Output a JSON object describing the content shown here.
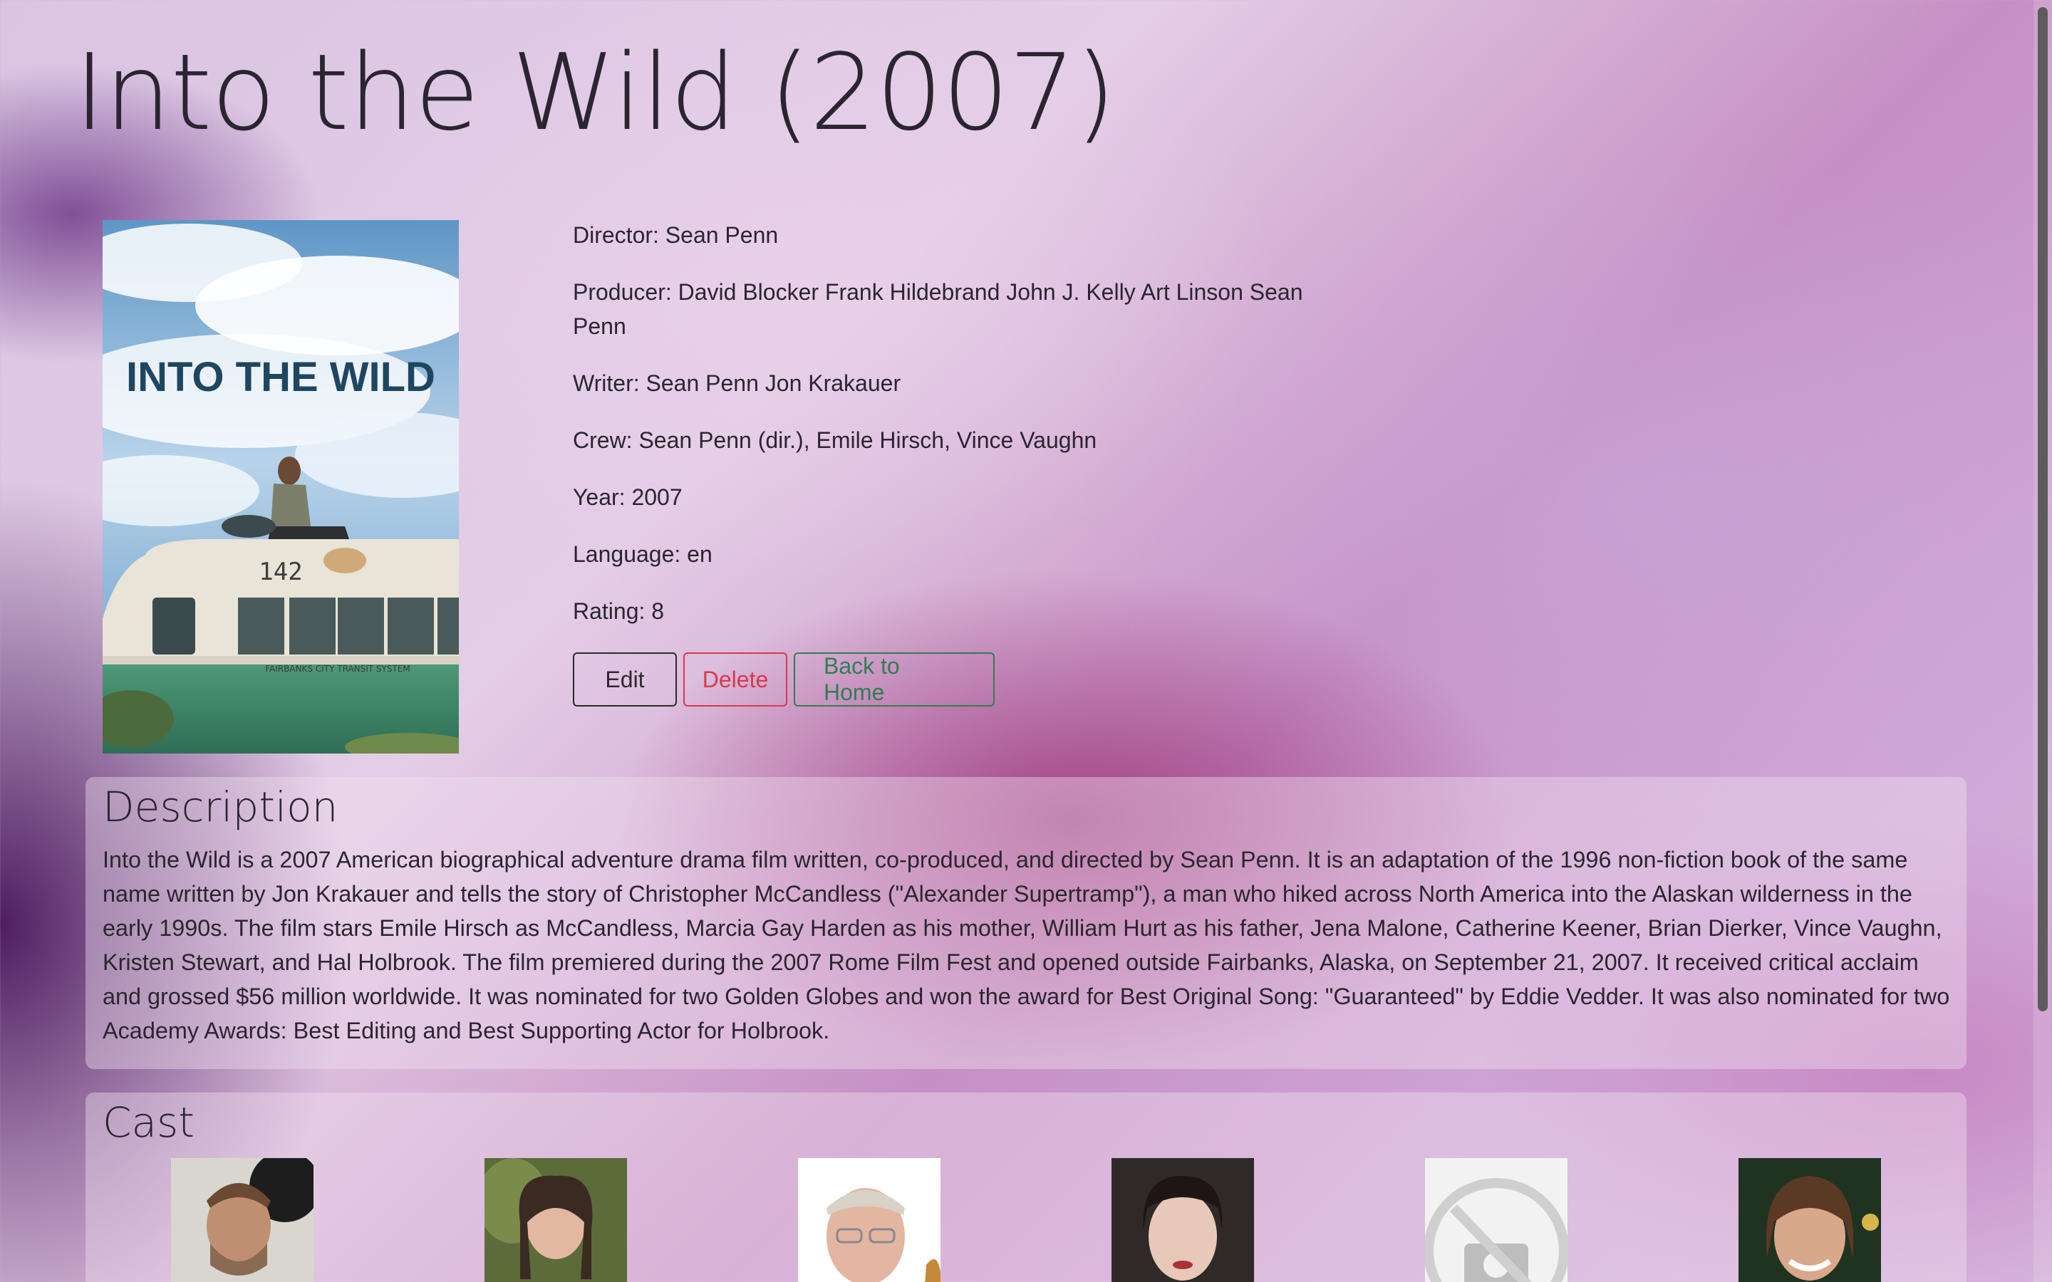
{
  "movie": {
    "title": "Into the Wild (2007)",
    "poster_title": "INTO THE WILD",
    "poster_bus_number": "142",
    "poster_bus_text": "FAIRBANKS CITY TRANSIT SYSTEM",
    "director": "Director: Sean Penn",
    "producer": "Producer: David Blocker Frank Hildebrand John J. Kelly Art Linson Sean Penn",
    "writer": "Writer: Sean Penn Jon Krakauer",
    "crew": "Crew: Sean Penn (dir.), Emile Hirsch, Vince Vaughn",
    "year": "Year: 2007",
    "language": "Language: en",
    "rating": "Rating: 8"
  },
  "actions": {
    "edit": "Edit",
    "delete": "Delete",
    "home": "Back to Home"
  },
  "description": {
    "heading": "Description",
    "text": "Into the Wild is a 2007 American biographical adventure drama film written, co-produced, and directed by Sean Penn. It is an adaptation of the 1996 non-fiction book of the same name written by Jon Krakauer and tells the story of Christopher McCandless (\"Alexander Supertramp\"), a man who hiked across North America into the Alaskan wilderness in the early 1990s. The film stars Emile Hirsch as McCandless, Marcia Gay Harden as his mother, William Hurt as his father, Jena Malone, Catherine Keener, Brian Dierker, Vince Vaughn, Kristen Stewart, and Hal Holbrook. The film premiered during the 2007 Rome Film Fest and opened outside Fairbanks, Alaska, on September 21, 2007. It received critical acclaim and grossed $56 million worldwide. It was nominated for two Golden Globes and won the award for Best Original Song: \"Guaranteed\" by Eddie Vedder. It was also nominated for two Academy Awards: Best Editing and Best Supporting Actor for Holbrook."
  },
  "cast": {
    "heading": "Cast",
    "photos": [
      "cast-photo",
      "cast-photo",
      "cast-photo",
      "cast-photo",
      "no-photo-icon",
      "cast-photo"
    ]
  },
  "colors": {
    "edit": "#2b2b2b",
    "delete": "#d9394b",
    "home": "#2f7d52"
  }
}
